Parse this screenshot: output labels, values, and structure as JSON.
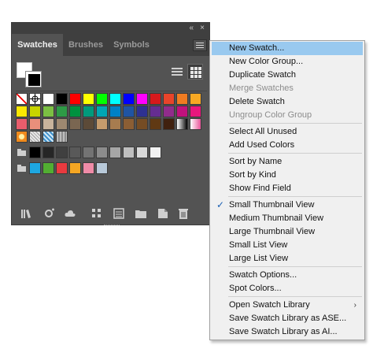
{
  "panel": {
    "collapse_icon": "«",
    "close_icon": "×",
    "tabs": [
      "Swatches",
      "Brushes",
      "Symbols"
    ],
    "active_tab": "Swatches",
    "view_mode": "Small Thumbnail View"
  },
  "swatch_rows": [
    [
      "none",
      "registration",
      "#ffffff",
      "#000000",
      "#ff0000",
      "#ffff00",
      "#00ff00",
      "#00ffff",
      "#0000ff",
      "#ff00ff",
      "#d7191c",
      "#e8442a",
      "#f07b21",
      "#f7a823"
    ],
    [
      "#fbe800",
      "#c8d400",
      "#7bbf43",
      "#2e9a46",
      "#00923f",
      "#009a7c",
      "#00a6b4",
      "#0081c6",
      "#1f54a3",
      "#2e3192",
      "#652d91",
      "#912c8b",
      "#c1127d",
      "#e8177d"
    ],
    [
      "#e85d6c",
      "#e98f7b",
      "#c8b39c",
      "#9e8870",
      "#7a6651",
      "#5c4a38",
      "#c69c6d",
      "#a77c4f",
      "#8b5e34",
      "#754c24",
      "#603913",
      "#40210f",
      "gradient-bw",
      "gradient-pink"
    ],
    [
      "pattern-orange",
      "pattern-dots",
      "pattern-blue",
      "pattern-gray"
    ],
    [
      "folder",
      "#000000",
      "#262626",
      "#404040",
      "#595959",
      "#737373",
      "#8c8c8c",
      "#a6a6a6",
      "#bfbfbf",
      "#d9d9d9",
      "#f2f2f2"
    ],
    [
      "folder",
      "#1ea7e1",
      "#52ae32",
      "#e93a3f",
      "#f5a623",
      "#ef8ba7",
      "#b8c9d9"
    ]
  ],
  "bottom_icons": [
    "libraries-icon",
    "show-kinds-icon",
    "cloud-icon",
    "swatch-options-icon",
    "color-group-icon",
    "new-folder-icon",
    "new-swatch-icon",
    "delete-icon"
  ],
  "menu": {
    "items": [
      {
        "label": "New Swatch...",
        "state": "highlighted"
      },
      {
        "label": "New Color Group...",
        "state": "normal"
      },
      {
        "label": "Duplicate Swatch",
        "state": "normal"
      },
      {
        "label": "Merge Swatches",
        "state": "disabled"
      },
      {
        "label": "Delete Swatch",
        "state": "normal"
      },
      {
        "label": "Ungroup Color Group",
        "state": "disabled"
      },
      {
        "label": "Select All Unused",
        "state": "normal"
      },
      {
        "label": "Add Used Colors",
        "state": "normal"
      },
      {
        "label": "Sort by Name",
        "state": "normal"
      },
      {
        "label": "Sort by Kind",
        "state": "normal"
      },
      {
        "label": "Show Find Field",
        "state": "normal"
      },
      {
        "label": "Small Thumbnail View",
        "state": "checked"
      },
      {
        "label": "Medium Thumbnail View",
        "state": "normal"
      },
      {
        "label": "Large Thumbnail View",
        "state": "normal"
      },
      {
        "label": "Small List View",
        "state": "normal"
      },
      {
        "label": "Large List View",
        "state": "normal"
      },
      {
        "label": "Swatch Options...",
        "state": "normal"
      },
      {
        "label": "Spot Colors...",
        "state": "normal"
      },
      {
        "label": "Open Swatch Library",
        "state": "submenu"
      },
      {
        "label": "Save Swatch Library as ASE...",
        "state": "normal"
      },
      {
        "label": "Save Swatch Library as AI...",
        "state": "normal"
      }
    ],
    "checkmark": "✓",
    "submenu_arrow": "›",
    "highlight_color": "#99c9ef"
  }
}
